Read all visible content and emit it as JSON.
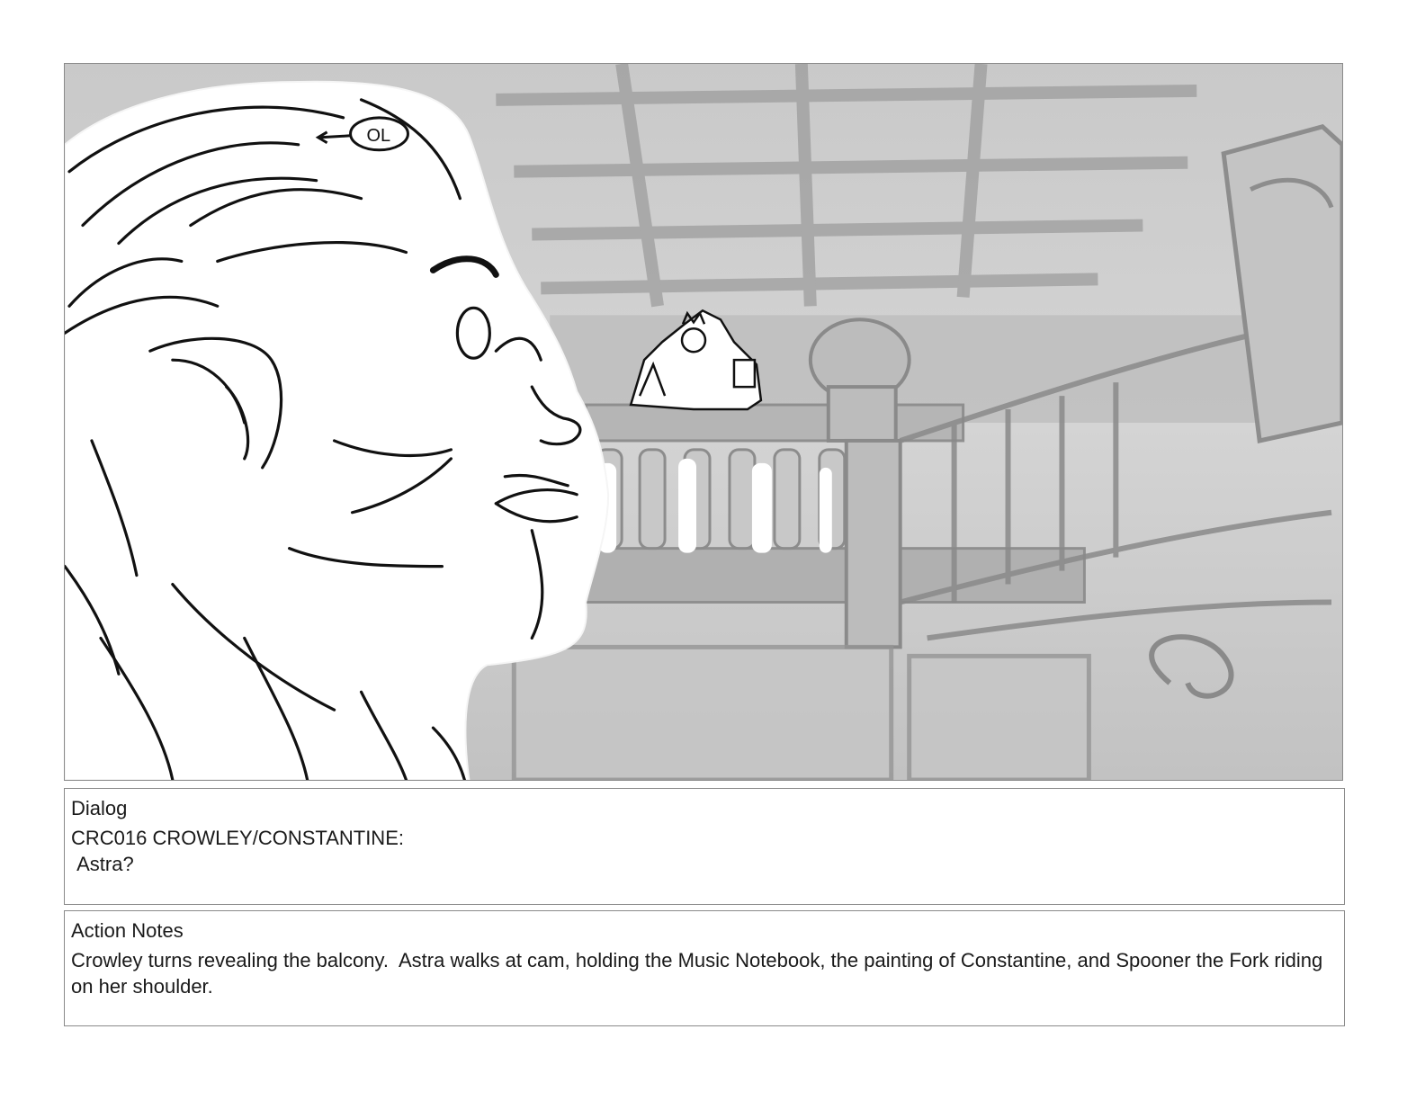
{
  "frame": {
    "drawing": "storyboard-panel",
    "annotation_badge": "OL"
  },
  "dialog": {
    "title": "Dialog",
    "character_line": "CRC016 CROWLEY/CONSTANTINE:",
    "line": " Astra?"
  },
  "action_notes": {
    "title": "Action Notes",
    "text": "Crowley turns revealing the balcony.  Astra walks at cam, holding the Music Notebook, the painting of Constantine, and Spooner the Fork riding on her shoulder."
  }
}
